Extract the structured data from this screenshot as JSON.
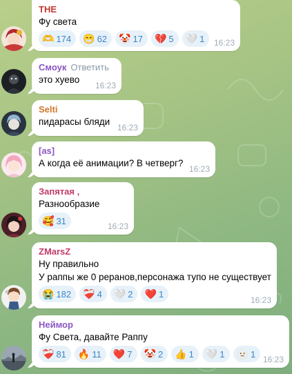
{
  "messages": [
    {
      "author": "THE",
      "author_color": "#c0382e",
      "reply_label": "",
      "lines": [
        "Фу света"
      ],
      "time": "16:23",
      "avatar_icon": "anime-girl-red-avatar-icon",
      "reactions": [
        {
          "emoji": "🫶",
          "icon": "heart-hands-icon",
          "count": "174"
        },
        {
          "emoji": "😁",
          "icon": "grinning-face-icon",
          "count": "62"
        },
        {
          "emoji": "🤡",
          "icon": "clown-face-icon",
          "count": "17"
        },
        {
          "emoji": "💔",
          "icon": "broken-heart-icon",
          "count": "5"
        },
        {
          "emoji": "🤍",
          "icon": "white-heart-icon",
          "count": "1"
        }
      ]
    },
    {
      "author": "Смоук",
      "author_color": "#8a56c2",
      "reply_label": "Ответить",
      "lines": [
        "это хуево"
      ],
      "time": "16:23",
      "avatar_icon": "dark-figure-avatar-icon",
      "reactions": []
    },
    {
      "author": "Selti",
      "author_color": "#d2772b",
      "reply_label": "",
      "lines": [
        "пидарасы бляди"
      ],
      "time": "16:23",
      "avatar_icon": "blue-haired-avatar-icon",
      "reactions": []
    },
    {
      "author": "[as]",
      "author_color": "#8a56c2",
      "reply_label": "",
      "lines": [
        "А когда её анимации? В четверг?"
      ],
      "time": "16:23",
      "avatar_icon": "pink-haired-avatar-icon",
      "reactions": []
    },
    {
      "author": "Запятая ,",
      "author_color": "#c23a6a",
      "reply_label": "",
      "lines": [
        "Разнообразие"
      ],
      "time": "16:23",
      "avatar_icon": "dark-haired-avatar-icon",
      "reactions": [
        {
          "emoji": "🥰",
          "icon": "smiling-face-hearts-icon",
          "count": "31"
        }
      ]
    },
    {
      "author": "ZMarsZ",
      "author_color": "#c23a6a",
      "reply_label": "",
      "lines": [
        "Ну правильно",
        "У раппы же 0 реранов,персонажа тупо не существует"
      ],
      "time": "16:23",
      "avatar_icon": "chibi-character-avatar-icon",
      "reactions": [
        {
          "emoji": "😭",
          "icon": "crying-face-icon",
          "count": "182"
        },
        {
          "emoji": "❤️‍🩹",
          "icon": "mending-heart-icon",
          "count": "4"
        },
        {
          "emoji": "🤍",
          "icon": "white-heart-icon",
          "count": "2"
        },
        {
          "emoji": "❤️",
          "icon": "red-heart-icon",
          "count": "1"
        }
      ]
    },
    {
      "author": "Неймор",
      "author_color": "#8a56c2",
      "reply_label": "",
      "lines": [
        "Фу Света, давайте Раппу"
      ],
      "time": "16:23",
      "avatar_icon": "landscape-avatar-icon",
      "reactions": [
        {
          "emoji": "❤️‍🩹",
          "icon": "mending-heart-icon",
          "count": "81"
        },
        {
          "emoji": "🔥",
          "icon": "fire-icon",
          "count": "11"
        },
        {
          "emoji": "❤️",
          "icon": "red-heart-icon",
          "count": "7"
        },
        {
          "emoji": "🤡",
          "icon": "clown-face-icon",
          "count": "2"
        },
        {
          "emoji": "👍",
          "icon": "thumbs-up-icon",
          "count": "1"
        },
        {
          "emoji": "🤍",
          "icon": "white-heart-icon",
          "count": "1"
        },
        {
          "emoji": "🫥",
          "icon": "custom-sticker-icon",
          "count": "1"
        }
      ]
    }
  ]
}
